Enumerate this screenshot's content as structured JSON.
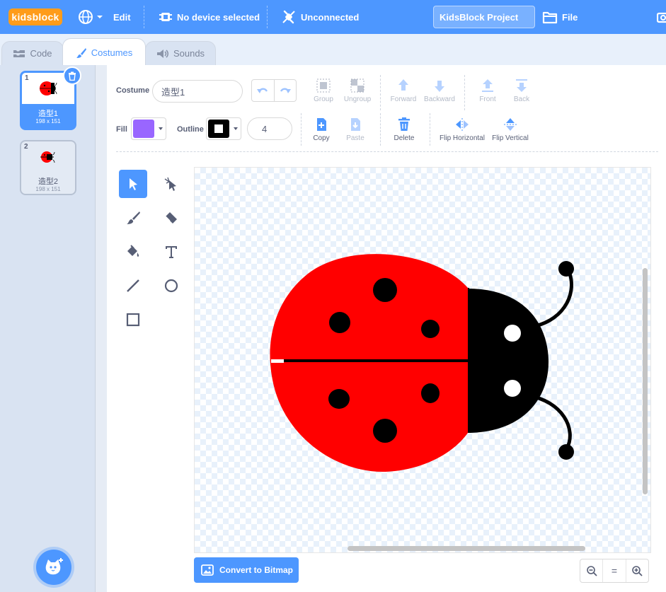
{
  "menu": {
    "logo": "kidsblock",
    "edit": "Edit",
    "device": "No device selected",
    "connection": "Unconnected",
    "project_title": "KidsBlock Project",
    "file": "File"
  },
  "tabs": [
    {
      "label": "Code"
    },
    {
      "label": "Costumes"
    },
    {
      "label": "Sounds"
    }
  ],
  "costumes": [
    {
      "number": "1",
      "name": "造型1",
      "size": "198 x 151"
    },
    {
      "number": "2",
      "name": "造型2",
      "size": "198 x 151"
    }
  ],
  "editor": {
    "costume_label": "Costume",
    "costume_name": "造型1",
    "fill_label": "Fill",
    "outline_label": "Outline",
    "outline_width": "4",
    "fill_color": "#9966ff",
    "outline_color": "#000000",
    "buttons": {
      "group": "Group",
      "ungroup": "Ungroup",
      "forward": "Forward",
      "backward": "Backward",
      "front": "Front",
      "back": "Back",
      "copy": "Copy",
      "paste": "Paste",
      "delete": "Delete",
      "flip_h": "Flip Horizontal",
      "flip_v": "Flip Vertical"
    },
    "convert": "Convert to Bitmap",
    "zoom_reset": "="
  },
  "colors": {
    "accent": "#4d97ff",
    "logo": "#ff9c1a",
    "ladybug_red": "#ff0000"
  }
}
